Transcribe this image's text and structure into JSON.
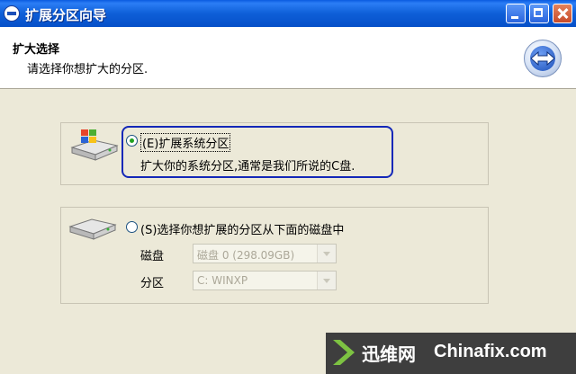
{
  "window": {
    "title": "扩展分区向导"
  },
  "header": {
    "title": "扩大选择",
    "subtitle": "请选择你想扩大的分区."
  },
  "options": [
    {
      "label": "(E)扩展系统分区",
      "description": "扩大你的系统分区,通常是我们所说的C盘.",
      "selected": true
    },
    {
      "label": "(S)选择你想扩展的分区从下面的磁盘中",
      "selected": false,
      "fields": {
        "disk_label": "磁盘",
        "disk_value": "磁盘 0 (298.09GB)",
        "partition_label": "分区",
        "partition_value": "C: WINXP"
      }
    }
  ],
  "watermark": {
    "cn": "迅维网",
    "en": "Chinafix.com"
  },
  "colors": {
    "titlebar": "#0a5be0",
    "highlight_border": "#1428b8",
    "radio_dot": "#21a121"
  }
}
